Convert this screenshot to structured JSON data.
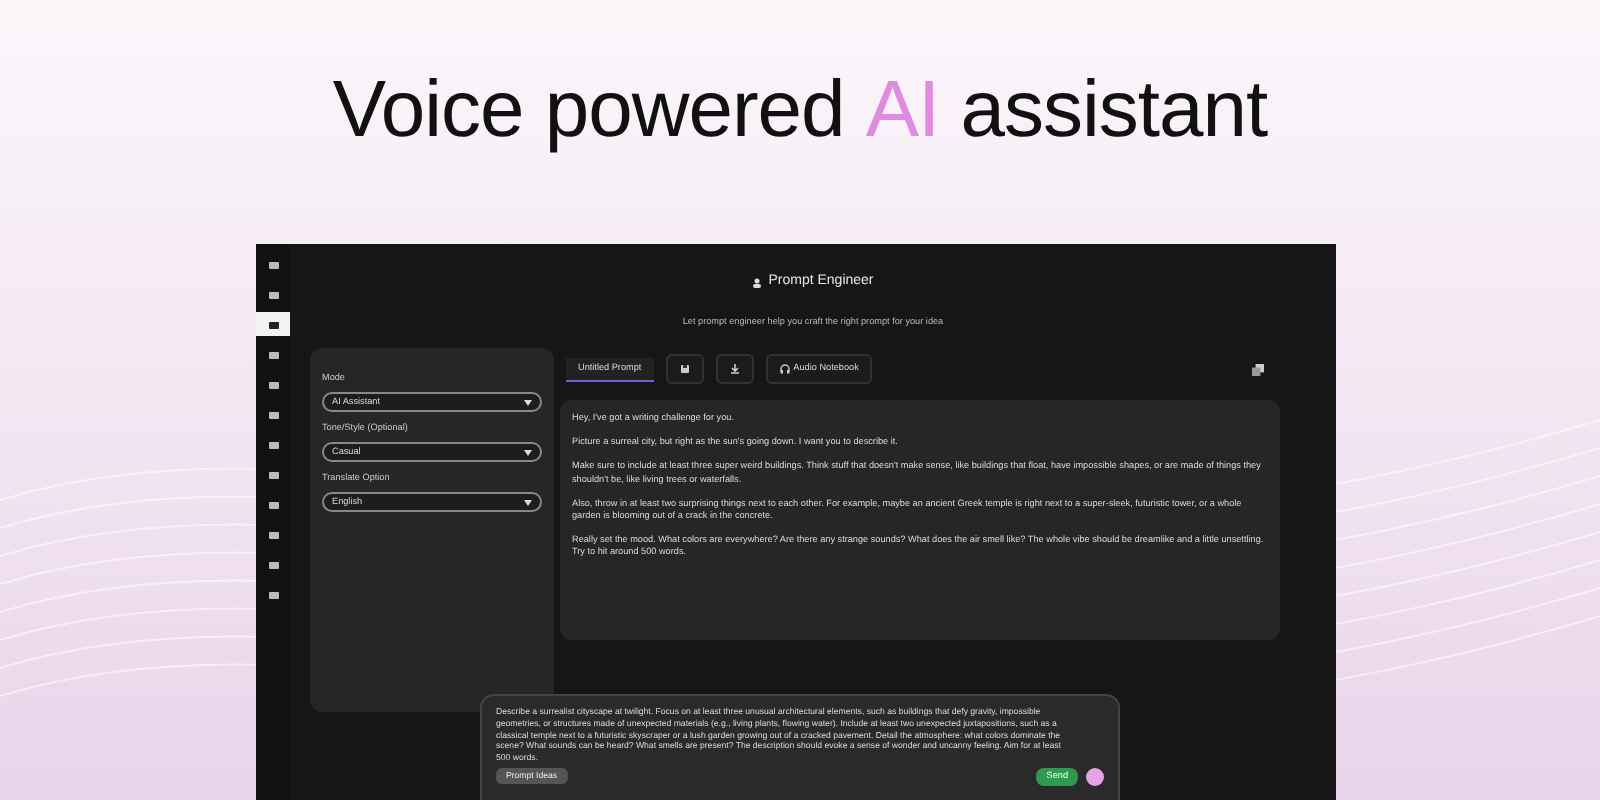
{
  "headline": [
    {
      "text": "Voice powered ",
      "accent": false
    },
    {
      "text": "AI",
      "accent": true
    },
    {
      "text": " assistant",
      "accent": false
    }
  ],
  "sidebar": {
    "items": [
      {
        "selected": false
      },
      {
        "selected": false
      },
      {
        "selected": true
      },
      {
        "selected": false
      },
      {
        "selected": false
      },
      {
        "selected": false
      },
      {
        "selected": false
      },
      {
        "selected": false
      },
      {
        "selected": false
      },
      {
        "selected": false
      },
      {
        "selected": false
      },
      {
        "selected": false
      }
    ]
  },
  "header": {
    "title": "Prompt Engineer",
    "subtitle": "Let prompt engineer help you craft the right prompt for your idea"
  },
  "settings": [
    {
      "label": "Mode",
      "value": "AI Assistant"
    },
    {
      "label": "Tone/Style (Optional)",
      "value": "Casual"
    },
    {
      "label": "Translate Option",
      "value": "English"
    }
  ],
  "tabs": [
    {
      "kind": "text",
      "label": "Untitled Prompt",
      "selected": true
    },
    {
      "kind": "save",
      "selected": false
    },
    {
      "kind": "download",
      "selected": false
    },
    {
      "kind": "audio",
      "label": "Audio Notebook",
      "selected": false
    }
  ],
  "output": [
    "Hey, I've got a writing challenge for you.",
    "Picture a surreal city, but right as the sun's going down. I want you to describe it.",
    "Make sure to include at least three super weird buildings. Think stuff that doesn't make sense, like buildings that float, have impossible shapes, or are made of things they shouldn't be, like living trees or waterfalls.",
    "Also, throw in at least two surprising things next to each other. For example, maybe an ancient Greek temple is right next to a super-sleek, futuristic tower, or a whole garden is blooming out of a crack in the concrete.",
    "Really set the mood. What colors are everywhere? Are there any strange sounds? What does the air smell like? The whole vibe should be dreamlike and a little unsettling. Try to hit around 500 words."
  ],
  "composer": {
    "text": "Describe a surrealist cityscape at twilight. Focus on at least three unusual architectural elements, such as buildings that defy gravity, impossible geometries, or structures made of unexpected materials (e.g., living plants, flowing water). Include at least two unexpected juxtapositions, such as a classical temple next to a futuristic skyscraper or a lush garden growing out of a cracked pavement. Detail the atmosphere: what colors dominate the scene? What sounds can be heard? What smells are present? The description should evoke a sense of wonder and uncanny feeling. Aim for at least 500 words.",
    "ideas_button": "Prompt Ideas",
    "send_button": "Send"
  }
}
